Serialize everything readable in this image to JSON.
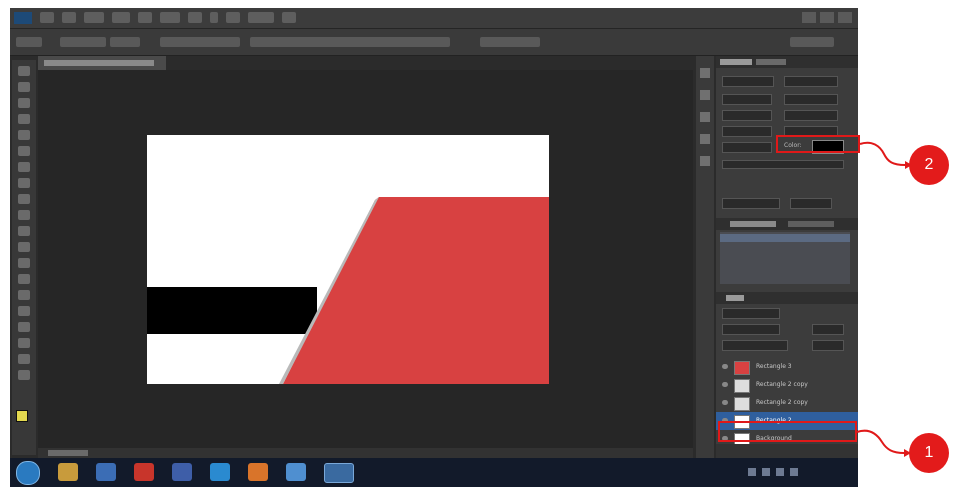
{
  "character_panel": {
    "color_label": "Color:",
    "color_value": "#000000"
  },
  "layers_panel": {
    "layers": [
      {
        "name": "Rectangle 3",
        "thumb": "#d84141"
      },
      {
        "name": "Rectangle 2 copy",
        "thumb": "#dddddd"
      },
      {
        "name": "Rectangle 2 copy",
        "thumb": "#dddddd"
      },
      {
        "name": "Rectangle 2",
        "thumb": "#ffffff"
      },
      {
        "name": "Background",
        "thumb": "#ffffff"
      }
    ],
    "selected_index": 3
  },
  "callouts": [
    {
      "label": "1"
    },
    {
      "label": "2"
    }
  ],
  "icons": [
    "photoshop-logo-icon",
    "start-orb-icon",
    "eye-icon"
  ],
  "colors": {
    "ui_dark": "#2b2b2b",
    "panel": "#3c3c3c",
    "accent_red": "#d84141",
    "selection_blue": "#2f5f9e",
    "callout_red": "#e31b1b"
  }
}
